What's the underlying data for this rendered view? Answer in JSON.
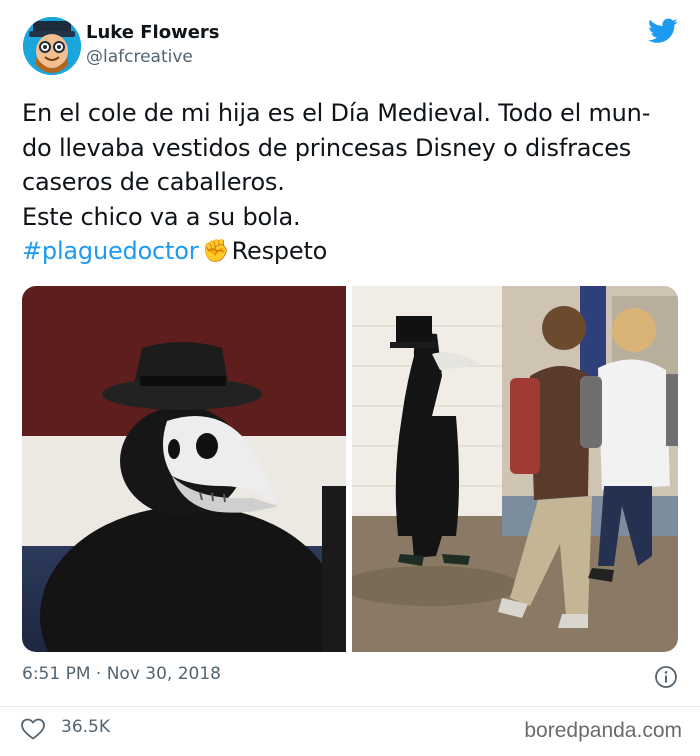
{
  "author": {
    "display_name": "Luke Flowers",
    "handle": "@lafcreative"
  },
  "tweet": {
    "lines": [
      "En el cole de mi hija es el Día Medieval. Todo el mun-",
      "do llevaba vestidos de princesas Disney o disfraces",
      "caseros de caballeros.",
      "Este chico va a su bola."
    ],
    "hashtag": "#plaguedoctor",
    "emoji": "✊",
    "after_hashtag": "Respeto"
  },
  "meta": {
    "timestamp": "6:51 PM · Nov 30, 2018",
    "like_count": "36.5K"
  },
  "watermark": "boredpanda.com",
  "icons": {
    "brand": "twitter-bird-icon",
    "info": "info-icon",
    "like": "heart-icon"
  },
  "colors": {
    "link": "#1d9bf0",
    "secondary_text": "#536471",
    "twitter_blue": "#1d9bf0"
  }
}
